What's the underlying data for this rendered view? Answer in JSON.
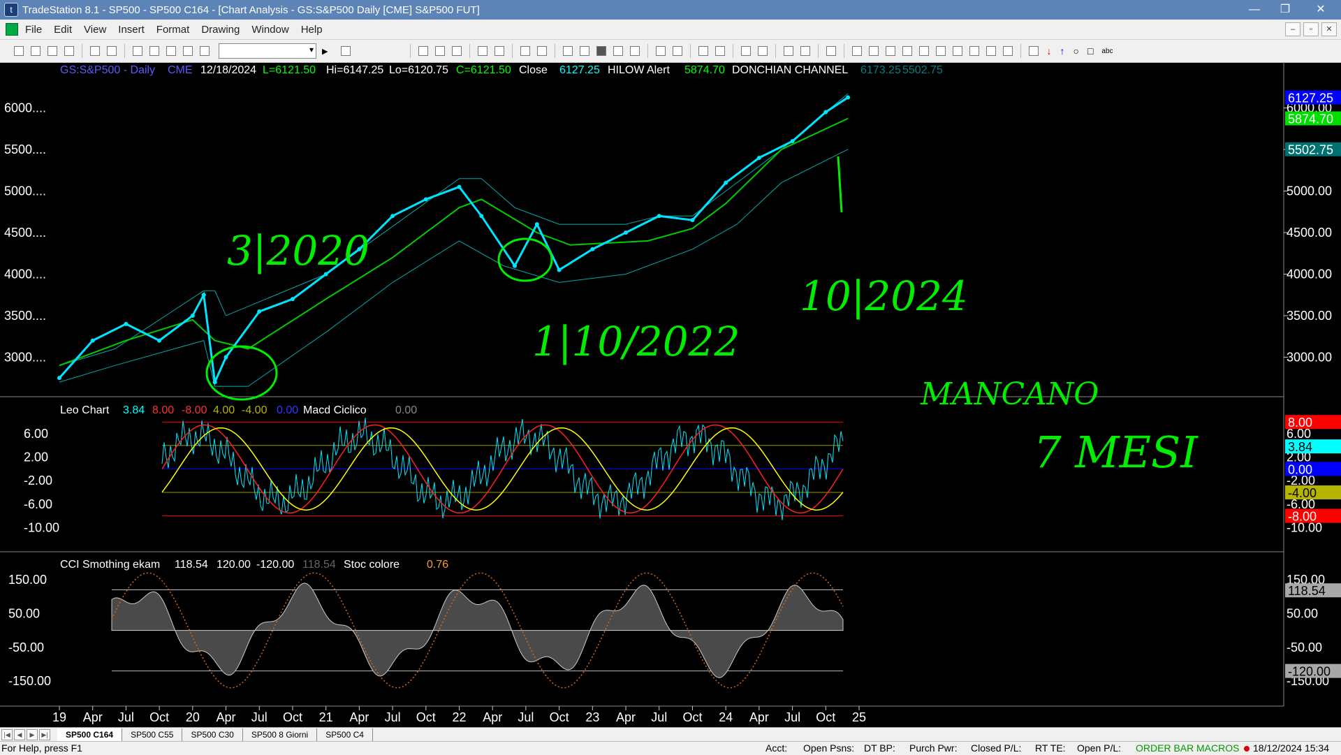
{
  "window": {
    "title": "TradeStation 8.1 - SP500 - SP500 C164 - [Chart Analysis - GS:S&P500  Daily  [CME] S&P500 FUT]",
    "btn_minimize": "—",
    "btn_maximize": "❐",
    "btn_close": "✕"
  },
  "menu": {
    "items": [
      "File",
      "Edit",
      "View",
      "Insert",
      "Format",
      "Drawing",
      "Window",
      "Help"
    ],
    "mdi": [
      "–",
      "▫",
      "✕"
    ]
  },
  "toolbar": {
    "symbol_select_value": ""
  },
  "chart_data": [
    {
      "type": "line",
      "title": "GS:S&P500 - Daily",
      "header": {
        "symbol": "GS:S&P500 - Daily",
        "exchange": "CME",
        "date": "12/18/2024",
        "last": "L=6121.50",
        "high": "Hi=6147.25",
        "low": "Lo=6120.75",
        "close_label": "C=6121.50",
        "close_word": "Close",
        "close_value": "6127.25",
        "hilow_label": "HILOW Alert",
        "hilow_value": "5874.70",
        "donchian_label": "DONCHIAN CHANNEL",
        "donchian_upper": "6173.25",
        "donchian_lower": "5502.75"
      },
      "ylim": [
        2600,
        6400
      ],
      "yticks_left": [
        "6000....",
        "5500....",
        "5000....",
        "4500....",
        "4000....",
        "3500....",
        "3000...."
      ],
      "yticks_right": [
        "6000.00",
        "5500.00",
        "5000.00",
        "4500.00",
        "4000.00",
        "3500.00",
        "3000.00"
      ],
      "ytick_values": [
        6000,
        5500,
        5000,
        4500,
        4000,
        3500,
        3000
      ],
      "right_flags": [
        {
          "text": "6127.25",
          "value": 6127.25,
          "color": "#0000ff"
        },
        {
          "text": "5874.70",
          "value": 5874.7,
          "color": "#00dd00"
        },
        {
          "text": "5502.75",
          "value": 5502.75,
          "color": "#007070"
        }
      ],
      "series": [
        {
          "name": "Close",
          "color": "#00e5ff",
          "x": [
            "2019-01",
            "2019-04",
            "2019-07",
            "2019-10",
            "2020-01",
            "2020-02",
            "2020-03",
            "2020-04",
            "2020-07",
            "2020-10",
            "2021-01",
            "2021-04",
            "2021-07",
            "2021-10",
            "2022-01",
            "2022-03",
            "2022-06",
            "2022-08",
            "2022-10",
            "2023-01",
            "2023-04",
            "2023-07",
            "2023-10",
            "2024-01",
            "2024-04",
            "2024-07",
            "2024-10",
            "2024-12"
          ],
          "values": [
            2750,
            3200,
            3400,
            3200,
            3500,
            3750,
            2700,
            3000,
            3550,
            3700,
            4000,
            4300,
            4700,
            4900,
            5050,
            4700,
            4100,
            4600,
            4050,
            4300,
            4500,
            4700,
            4650,
            5100,
            5400,
            5600,
            5950,
            6127
          ]
        },
        {
          "name": "HILOW Alert",
          "color": "#00cc00",
          "x": [
            "2019-01",
            "2019-07",
            "2020-01",
            "2020-03",
            "2020-06",
            "2021-01",
            "2021-07",
            "2022-01",
            "2022-03",
            "2022-08",
            "2022-11",
            "2023-06",
            "2023-10",
            "2024-01",
            "2024-06",
            "2024-12"
          ],
          "values": [
            2900,
            3200,
            3450,
            3200,
            3100,
            3700,
            4200,
            4800,
            4900,
            4500,
            4350,
            4400,
            4550,
            4850,
            5500,
            5874
          ]
        },
        {
          "name": "DONCHIAN CHANNEL upper",
          "color": "#00aaaa",
          "x": [
            "2019-01",
            "2019-06",
            "2020-02",
            "2020-03",
            "2020-04",
            "2021-01",
            "2022-01",
            "2022-03",
            "2022-06",
            "2022-10",
            "2023-04",
            "2023-07",
            "2023-10",
            "2024-01",
            "2024-06",
            "2024-12"
          ],
          "values": [
            2900,
            3100,
            3800,
            3800,
            3500,
            4000,
            5150,
            5150,
            4800,
            4600,
            4600,
            4700,
            4700,
            5000,
            5500,
            6173
          ]
        },
        {
          "name": "DONCHIAN CHANNEL lower",
          "color": "#00aaaa",
          "x": [
            "2019-01",
            "2019-06",
            "2020-02",
            "2020-03",
            "2020-06",
            "2021-01",
            "2021-07",
            "2022-01",
            "2022-05",
            "2022-10",
            "2023-04",
            "2023-10",
            "2024-02",
            "2024-06",
            "2024-12"
          ],
          "values": [
            2700,
            2900,
            3200,
            2650,
            2650,
            3300,
            3900,
            4400,
            4100,
            3900,
            4000,
            4300,
            4600,
            5100,
            5502
          ]
        }
      ]
    },
    {
      "type": "line",
      "title": "Leo Chart",
      "header": {
        "name": "Leo Chart",
        "v1": "3.84",
        "v2": "8.00",
        "v3": "-8.00",
        "v4": "4.00",
        "v5": "-4.00",
        "v6": "0.00",
        "name2": "Macd Ciclico",
        "v7": "0.00"
      },
      "ylim": [
        -14,
        11
      ],
      "yticks_left": [
        "6.00",
        "2.00",
        "-2.00",
        "-6.00",
        "-10.00"
      ],
      "yticks_right": [
        "6.00",
        "2.00",
        "-2.00",
        "-6.00",
        "-10.00"
      ],
      "ytick_values": [
        6,
        2,
        -2,
        -6,
        -10
      ],
      "levels": [
        {
          "value": 8,
          "color": "#ff0000"
        },
        {
          "value": 4,
          "color": "#999900"
        },
        {
          "value": 0,
          "color": "#0000ff"
        },
        {
          "value": -4,
          "color": "#999900"
        },
        {
          "value": -8,
          "color": "#ff0000"
        }
      ],
      "right_flags": [
        {
          "text": "8.00",
          "value": 8,
          "color": "#ff0000"
        },
        {
          "text": "3.84",
          "value": 3.84,
          "color": "#00ffff"
        },
        {
          "text": "0.00",
          "value": 0,
          "color": "#0000ff"
        },
        {
          "text": "-4.00",
          "value": -4,
          "color": "#b5b500"
        },
        {
          "text": "-8.00",
          "value": -8,
          "color": "#ff0000"
        }
      ]
    },
    {
      "type": "area",
      "title": "CCI Smothing ekam",
      "header": {
        "name": "CCI Smothing ekam",
        "v1": "118.54",
        "v2": "120.00",
        "v3": "-120.00",
        "v4": "118.54",
        "name2": "Stoc colore",
        "v5": "0.76"
      },
      "ylim": [
        -220,
        210
      ],
      "yticks_left": [
        "150.00",
        "50.00",
        "-50.00",
        "-150.00"
      ],
      "yticks_right": [
        "150.00",
        "50.00",
        "-50.00",
        "-150.00"
      ],
      "ytick_values": [
        150,
        50,
        -50,
        -150
      ],
      "right_flags": [
        {
          "text": "118.54",
          "value": 118.54,
          "color": "#404040"
        },
        {
          "text": "-120.00",
          "value": -120,
          "color": "#404040"
        }
      ]
    }
  ],
  "xaxis": {
    "labels": [
      "19",
      "Apr",
      "Jul",
      "Oct",
      "20",
      "Apr",
      "Jul",
      "Oct",
      "21",
      "Apr",
      "Jul",
      "Oct",
      "22",
      "Apr",
      "Jul",
      "Oct",
      "23",
      "Apr",
      "Jul",
      "Oct",
      "24",
      "Apr",
      "Jul",
      "Oct",
      "25"
    ]
  },
  "annotations": {
    "a1": "3|2020",
    "a2": "1|10/2022",
    "a3": "10|2024",
    "a4": "MANCANO",
    "a5": "7 MESI"
  },
  "tabs": [
    "SP500 C164",
    "SP500 C55",
    "SP500 C30",
    "SP500 8 Giorni",
    "SP500 C4"
  ],
  "status": {
    "help": "For Help, press F1",
    "acct": "Acct:",
    "open_psns": "Open Psns:",
    "dt_bp": "DT BP:",
    "purch_pwr": "Purch Pwr:",
    "closed_pl": "Closed P/L:",
    "rt_te": "RT TE:",
    "open_pl": "Open P/L:",
    "order_bar": "ORDER BAR",
    "macros": "MACROS",
    "datetime": "18/12/2024 15:34"
  }
}
